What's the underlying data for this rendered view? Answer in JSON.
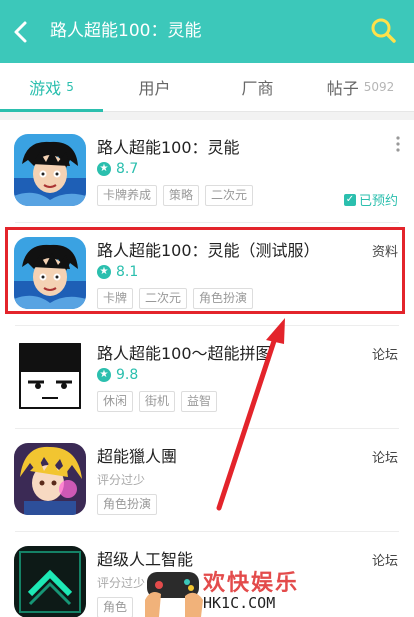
{
  "header": {
    "search_query": "路人超能100：灵能",
    "colors": {
      "bar": "#3cc8ba",
      "accent": "#ffe14a"
    }
  },
  "tabs": [
    {
      "label": "游戏",
      "count": "5",
      "active": true
    },
    {
      "label": "用户",
      "count": "",
      "active": false
    },
    {
      "label": "厂商",
      "count": "",
      "active": false
    },
    {
      "label": "帖子",
      "count": "5092",
      "active": false
    }
  ],
  "results": [
    {
      "title": "路人超能100：灵能",
      "rating": "8.7",
      "subtitle": "",
      "tags": [
        "卡牌养成",
        "策略",
        "二次元"
      ],
      "side": "",
      "reserved": "已预约",
      "icon": "mob-psycho-icon"
    },
    {
      "title": "路人超能100：灵能（测试服）",
      "rating": "8.1",
      "subtitle": "",
      "tags": [
        "卡牌",
        "二次元",
        "角色扮演"
      ],
      "side": "资料",
      "reserved": "",
      "icon": "mob-psycho-test-icon"
    },
    {
      "title": "路人超能100～超能拼图",
      "rating": "9.8",
      "subtitle": "",
      "tags": [
        "休闲",
        "街机",
        "益智"
      ],
      "side": "论坛",
      "reserved": "",
      "icon": "mob-face-icon"
    },
    {
      "title": "超能獵人團",
      "rating": "",
      "subtitle": "评分过少",
      "tags": [
        "角色扮演"
      ],
      "side": "论坛",
      "reserved": "",
      "icon": "hunter-team-icon"
    },
    {
      "title": "超级人工智能",
      "rating": "",
      "subtitle": "评分过少",
      "tags": [
        "角色"
      ],
      "side": "论坛",
      "reserved": "",
      "icon": "super-ai-icon"
    }
  ],
  "watermark": {
    "brand": "欢快娱乐",
    "site": "HK1C.COM"
  }
}
